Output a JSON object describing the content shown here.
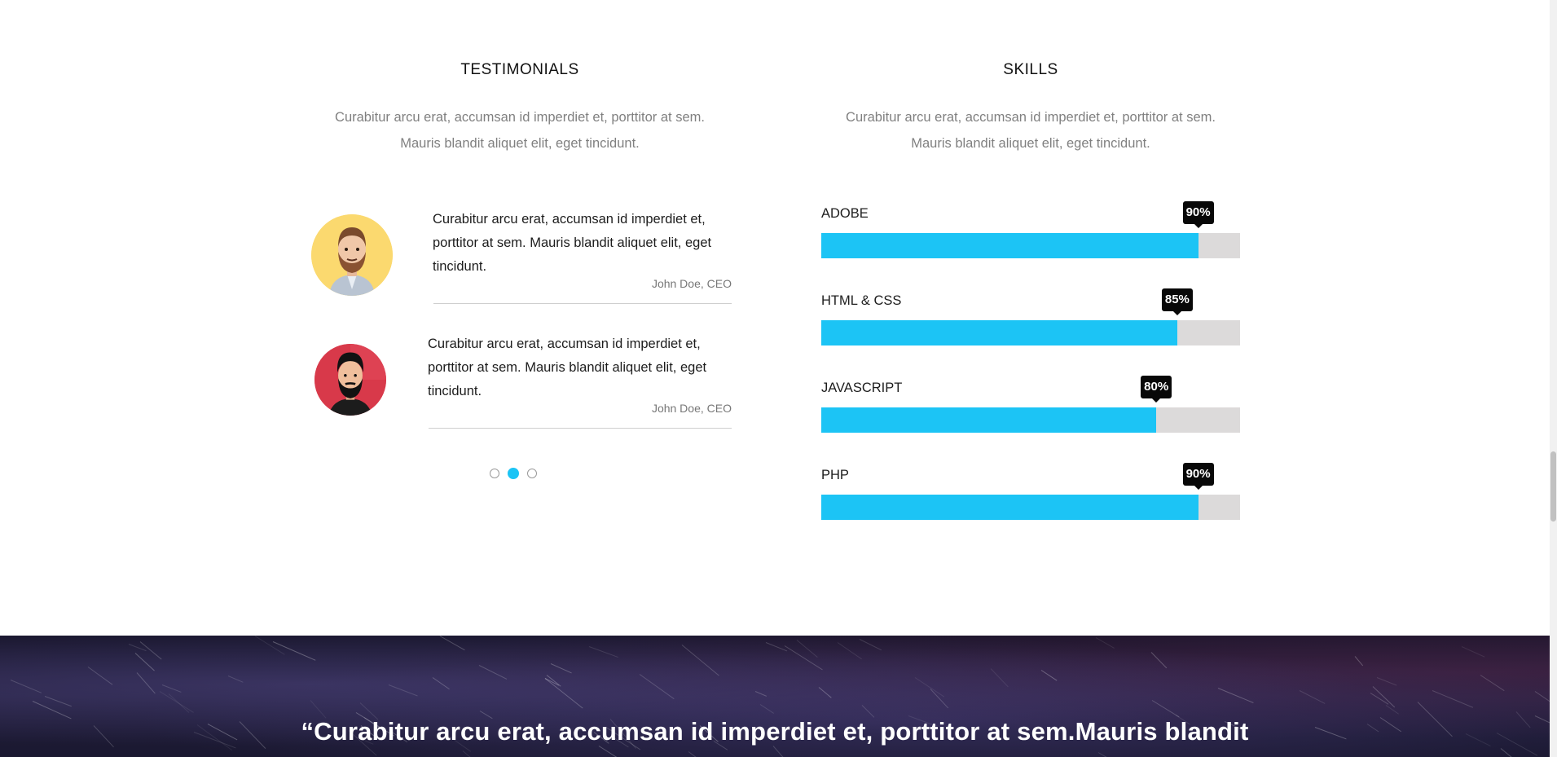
{
  "testimonials": {
    "title": "TESTIMONIALS",
    "subtitle_line1": "Curabitur arcu erat, accumsan id imperdiet et, porttitor at sem.",
    "subtitle_line2": "Mauris blandit aliquet elit, eget tincidunt.",
    "items": [
      {
        "text": "Curabitur arcu erat, accumsan id imperdiet et, porttitor at sem. Mauris blandit aliquet elit, eget tincidunt.",
        "author": "John Doe, CEO",
        "avatar_icon": "bearded-man-avatar-icon",
        "avatar_bg": "#fbd96f"
      },
      {
        "text": "Curabitur arcu erat, accumsan id imperdiet et, porttitor at sem. Mauris blandit aliquet elit, eget tincidunt.",
        "author": "John Doe, CEO",
        "avatar_icon": "bearded-man-avatar-icon",
        "avatar_bg": "#d8394a"
      }
    ],
    "pagination": {
      "total": 3,
      "active_index": 1
    }
  },
  "skills": {
    "title": "SKILLS",
    "subtitle_line1": "Curabitur arcu erat, accumsan id imperdiet et, porttitor at sem.",
    "subtitle_line2": "Mauris blandit aliquet elit, eget tincidunt.",
    "items": [
      {
        "label": "ADOBE",
        "percent": 90,
        "percent_label": "90%"
      },
      {
        "label": "HTML & CSS",
        "percent": 85,
        "percent_label": "85%"
      },
      {
        "label": "JAVASCRIPT",
        "percent": 80,
        "percent_label": "80%"
      },
      {
        "label": "PHP",
        "percent": 90,
        "percent_label": "90%"
      }
    ]
  },
  "banner": {
    "quote": "“Curabitur arcu erat, accumsan id imperdiet et, porttitor at sem.Mauris blandit"
  },
  "colors": {
    "accent": "#1cc4f5",
    "track": "#dcdada",
    "tooltip": "#080808"
  }
}
